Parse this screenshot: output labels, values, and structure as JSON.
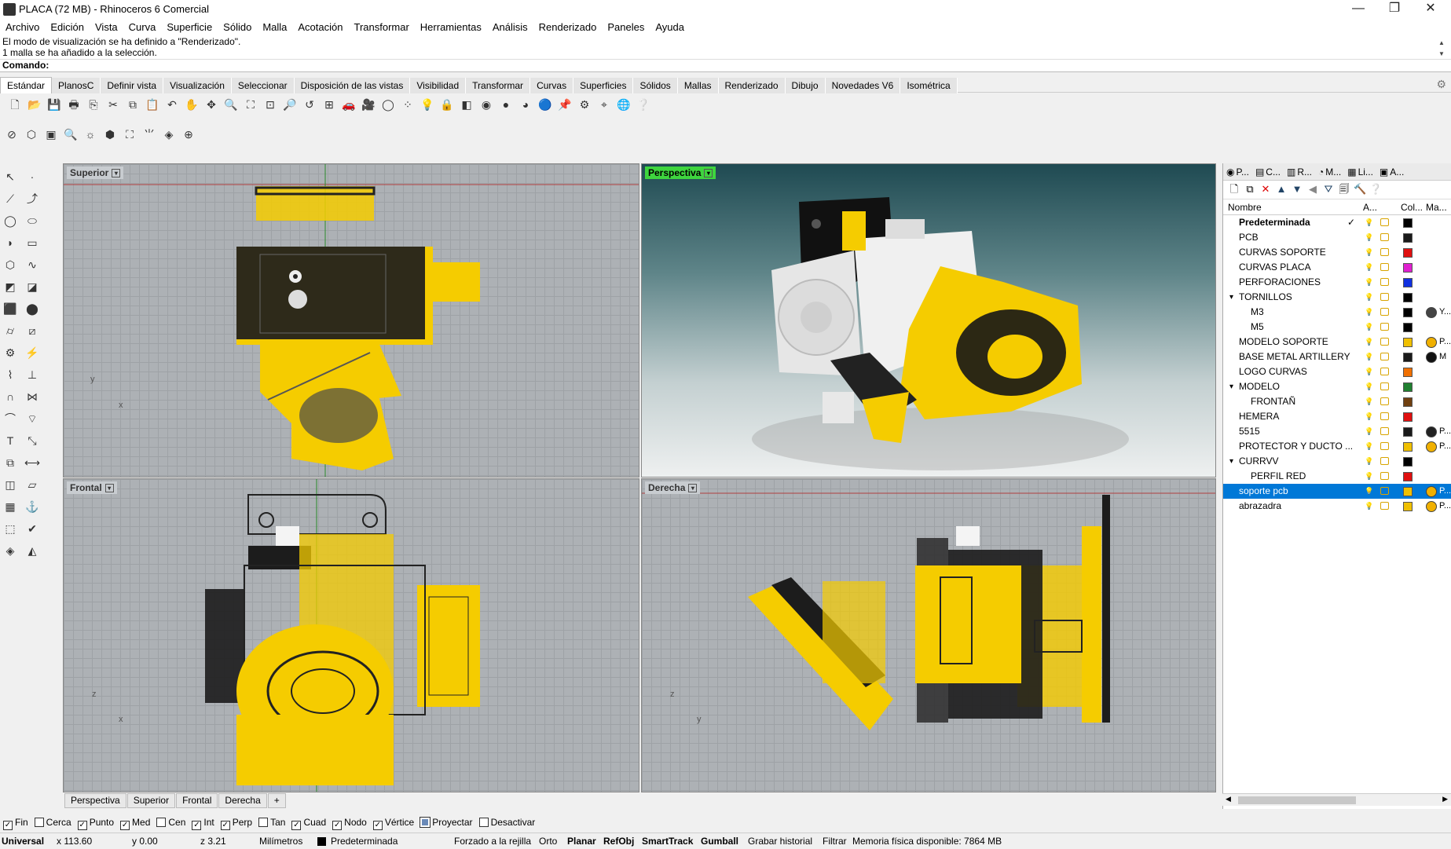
{
  "window": {
    "title": "PLACA (72 MB) - Rhinoceros 6 Comercial",
    "min": "—",
    "max": "❐",
    "close": "✕"
  },
  "menu": [
    "Archivo",
    "Edición",
    "Vista",
    "Curva",
    "Superficie",
    "Sólido",
    "Malla",
    "Acotación",
    "Transformar",
    "Herramientas",
    "Análisis",
    "Renderizado",
    "Paneles",
    "Ayuda"
  ],
  "history": [
    "El modo de visualización se ha definido a \"Renderizado\".",
    "1 malla se ha añadido a la selección."
  ],
  "command": {
    "label": "Comando:",
    "value": ""
  },
  "tabs": [
    "Estándar",
    "PlanosC",
    "Definir vista",
    "Visualización",
    "Seleccionar",
    "Disposición de las vistas",
    "Visibilidad",
    "Transformar",
    "Curvas",
    "Superficies",
    "Sólidos",
    "Mallas",
    "Renderizado",
    "Dibujo",
    "Novedades V6",
    "Isométrica"
  ],
  "viewports": {
    "top": "Superior",
    "persp": "Perspectiva",
    "front": "Frontal",
    "right": "Derecha"
  },
  "axes": {
    "x": "x",
    "y": "y",
    "z": "z"
  },
  "viewport_tabs": [
    "Perspectiva",
    "Superior",
    "Frontal",
    "Derecha",
    "+"
  ],
  "panel": {
    "tabs": [
      "P...",
      "C...",
      "R...",
      "M...",
      "Li...",
      "A..."
    ],
    "headers": {
      "name": "Nombre",
      "a": "A...",
      "col": "Col...",
      "mat": "Ma..."
    },
    "layers": [
      {
        "name": "Predeterminada",
        "bold": true,
        "indent": 0,
        "color": "#000000",
        "current": true
      },
      {
        "name": "PCB",
        "indent": 0,
        "color": "#1a1a1a"
      },
      {
        "name": "CURVAS SOPORTE",
        "indent": 0,
        "color": "#e01010"
      },
      {
        "name": "CURVAS PLACA",
        "indent": 0,
        "color": "#e020d0"
      },
      {
        "name": "PERFORACIONES",
        "indent": 0,
        "color": "#1030e0"
      },
      {
        "name": "TORNILLOS",
        "indent": 0,
        "color": "#000000",
        "twisty": "expanded"
      },
      {
        "name": "M3",
        "indent": 1,
        "color": "#000000",
        "mat": "#444444",
        "mtext": "Y..."
      },
      {
        "name": "M5",
        "indent": 1,
        "color": "#000000"
      },
      {
        "name": "MODELO SOPORTE",
        "indent": 0,
        "color": "#f0c000",
        "mat": "#f0b000",
        "mtext": "P..."
      },
      {
        "name": "BASE METAL ARTILLERY",
        "indent": 0,
        "color": "#1a1a1a",
        "mat": "#111111",
        "mtext": "M"
      },
      {
        "name": "LOGO CURVAS",
        "indent": 0,
        "color": "#f07000"
      },
      {
        "name": "MODELO",
        "indent": 0,
        "color": "#208030",
        "twisty": "expanded"
      },
      {
        "name": "FRONTAÑ",
        "indent": 1,
        "color": "#704010"
      },
      {
        "name": "HEMERA",
        "indent": 0,
        "color": "#e01010"
      },
      {
        "name": "5515",
        "indent": 0,
        "color": "#1a1a1a",
        "mat": "#222222",
        "mtext": "P..."
      },
      {
        "name": "PROTECTOR Y DUCTO ...",
        "indent": 0,
        "color": "#f0c000",
        "mat": "#f0b000",
        "mtext": "P..."
      },
      {
        "name": "CURRVV",
        "indent": 0,
        "color": "#000000",
        "twisty": "expanded"
      },
      {
        "name": "PERFIL RED",
        "indent": 1,
        "color": "#e01010"
      },
      {
        "name": "soporte pcb",
        "indent": 0,
        "color": "#f0c000",
        "mat": "#f0b000",
        "mtext": "P...",
        "selected": true
      },
      {
        "name": "abrazadra",
        "indent": 0,
        "color": "#f0c000",
        "mat": "#f0b000",
        "mtext": "P..."
      }
    ]
  },
  "osnaps": [
    {
      "label": "Fin",
      "checked": true
    },
    {
      "label": "Cerca",
      "checked": false
    },
    {
      "label": "Punto",
      "checked": true
    },
    {
      "label": "Med",
      "checked": true
    },
    {
      "label": "Cen",
      "checked": false
    },
    {
      "label": "Int",
      "checked": true
    },
    {
      "label": "Perp",
      "checked": true
    },
    {
      "label": "Tan",
      "checked": false
    },
    {
      "label": "Cuad",
      "checked": true
    },
    {
      "label": "Nodo",
      "checked": true
    },
    {
      "label": "Vértice",
      "checked": true
    },
    {
      "label": "Proyectar",
      "checked": true
    },
    {
      "label": "Desactivar",
      "checked": false
    }
  ],
  "status": {
    "cplane": "Universal",
    "x": "x 113.60",
    "y": "y 0.00",
    "z": "z 3.21",
    "units": "Milímetros",
    "layer": "Predeterminada",
    "grid": "Forzado a la rejilla",
    "ortho": "Orto",
    "planar": "Planar",
    "osnap": "RefObj",
    "smarttrack": "SmartTrack",
    "gumball": "Gumball",
    "history": "Grabar historial",
    "filter": "Filtrar",
    "memory": "Memoria física disponible: 7864 MB"
  },
  "colors": {
    "model_yellow": "#f5cc00",
    "select_blue": "#0078d7",
    "persp_label": "#3ed53e"
  }
}
